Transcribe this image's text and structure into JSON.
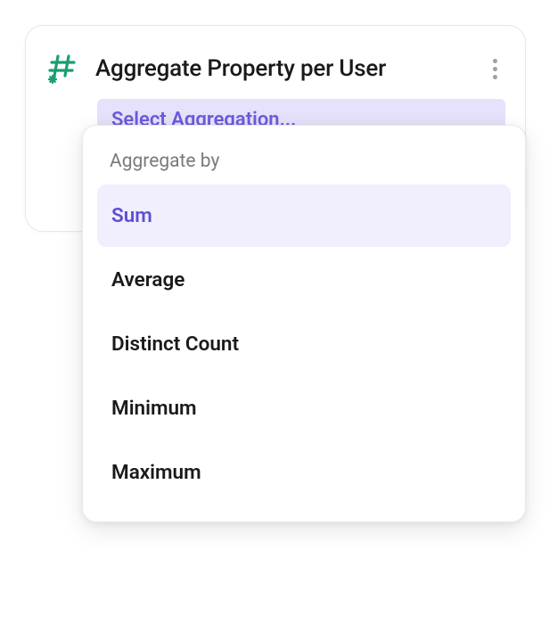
{
  "card": {
    "title": "Aggregate Property per User"
  },
  "select": {
    "placeholder": "Select Aggregation..."
  },
  "dropdown": {
    "label": "Aggregate by",
    "options": [
      {
        "label": "Sum",
        "selected": true
      },
      {
        "label": "Average",
        "selected": false
      },
      {
        "label": "Distinct Count",
        "selected": false
      },
      {
        "label": "Minimum",
        "selected": false
      },
      {
        "label": "Maximum",
        "selected": false
      }
    ]
  }
}
